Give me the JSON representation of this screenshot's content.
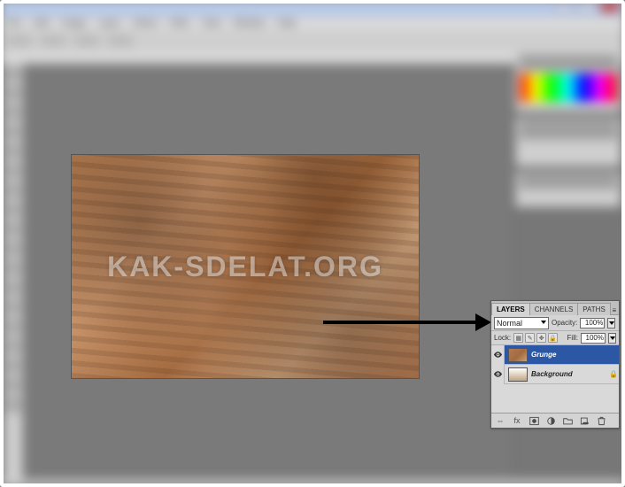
{
  "menubar": [
    "File",
    "Edit",
    "Image",
    "Layer",
    "Select",
    "Filter",
    "View",
    "Window",
    "Help"
  ],
  "watermark": "KAK-SDELAT.ORG",
  "layers_panel": {
    "tabs": {
      "layers": "LAYERS",
      "channels": "CHANNELS",
      "paths": "PATHS"
    },
    "blend_mode": "Normal",
    "opacity_label": "Opacity:",
    "opacity_value": "100%",
    "lock_label": "Lock:",
    "fill_label": "Fill:",
    "fill_value": "100%",
    "layers": [
      {
        "name": "Grunge",
        "selected": true,
        "locked": false
      },
      {
        "name": "Background",
        "selected": false,
        "locked": true
      }
    ]
  }
}
